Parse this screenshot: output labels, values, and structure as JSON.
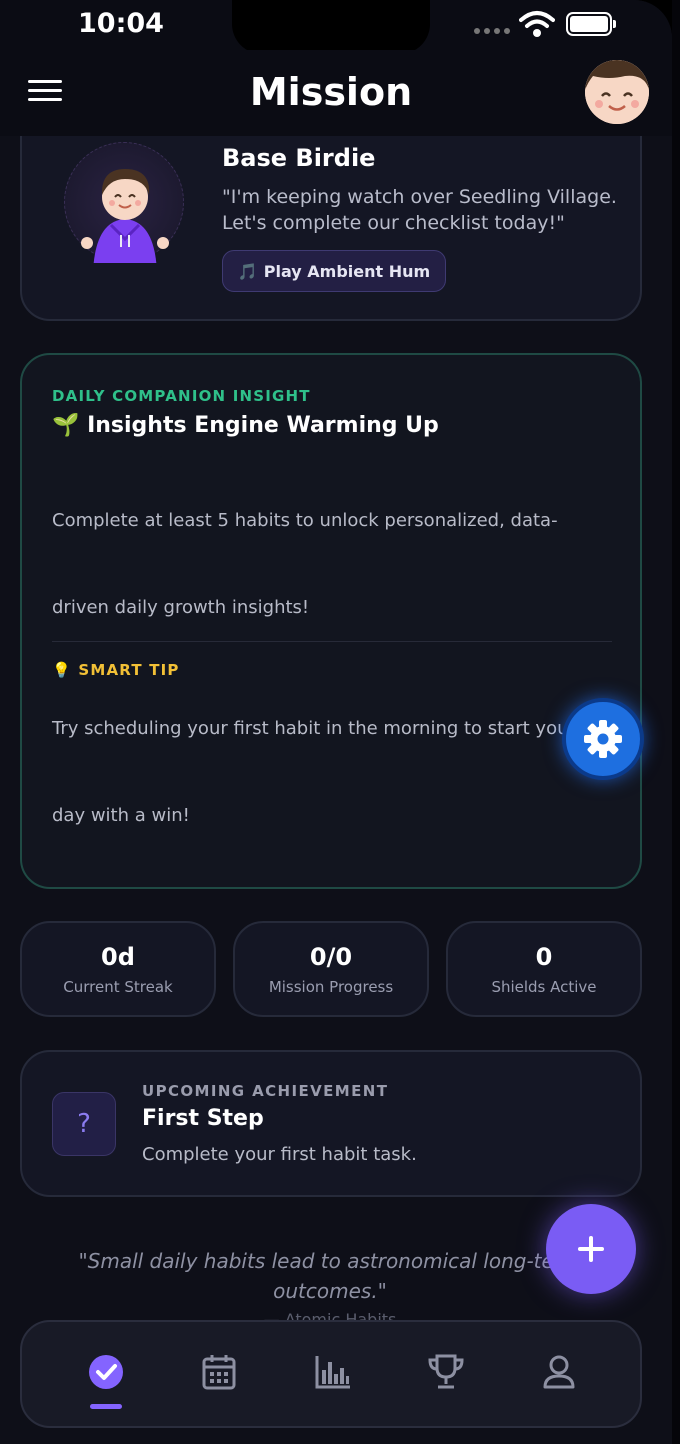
{
  "status_bar": {
    "time": "10:04"
  },
  "header": {
    "title": "Mission"
  },
  "companion": {
    "name": "Base Birdie",
    "quote": "\"I'm keeping watch over Seedling Village. Let's complete our checklist today!\"",
    "button_label": "Play Ambient Hum",
    "button_icon": "🎵"
  },
  "insight": {
    "kicker": "DAILY COMPANION INSIGHT",
    "title": "Insights Engine Warming Up",
    "title_icon": "🌱",
    "body": "Complete at least 5 habits to unlock personalized, data-driven daily growth insights!",
    "tip_kicker": "SMART TIP",
    "tip_icon": "💡",
    "tip_body": "Try scheduling your first habit in the morning to start your day with a win!"
  },
  "stats": [
    {
      "value": "0d",
      "label": "Current Streak"
    },
    {
      "value": "0/0",
      "label": "Mission Progress"
    },
    {
      "value": "0",
      "label": "Shields Active"
    }
  ],
  "achievement": {
    "kicker": "UPCOMING ACHIEVEMENT",
    "title": "First Step",
    "description": "Complete your first habit task.",
    "icon": "?"
  },
  "quote": {
    "text": "\"Small daily habits lead to astronomical long-term outcomes.\"",
    "author": "— Atomic Habits"
  },
  "tabs": [
    {
      "name": "missions",
      "icon": "check-circle-icon",
      "active": true
    },
    {
      "name": "calendar",
      "icon": "calendar-icon",
      "active": false
    },
    {
      "name": "stats",
      "icon": "bar-chart-icon",
      "active": false
    },
    {
      "name": "trophies",
      "icon": "trophy-icon",
      "active": false
    },
    {
      "name": "profile",
      "icon": "person-icon",
      "active": false
    }
  ],
  "colors": {
    "accent": "#7a5cf4",
    "insight_green": "#2fc08a",
    "tip_yellow": "#f2c036",
    "gear_blue": "#1e6fe0",
    "background": "#0e0f18"
  }
}
